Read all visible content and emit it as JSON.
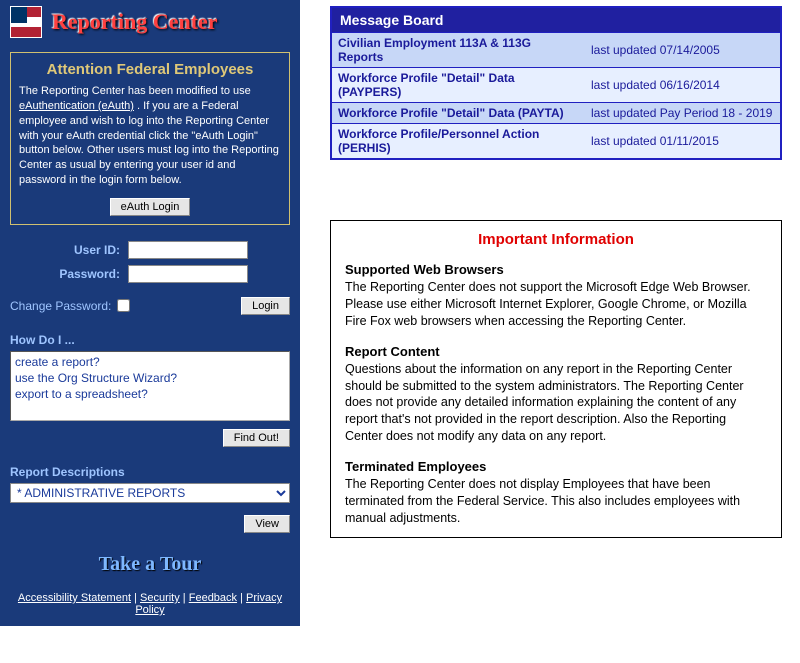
{
  "header": {
    "site_title": "Reporting Center"
  },
  "sidebar": {
    "attention": {
      "heading": "Attention Federal Employees",
      "text_pre": "The Reporting Center has been modified to use ",
      "eauth_link": "eAuthentication (eAuth)",
      "text_post": " . If you are a Federal employee and wish to log into the Reporting Center with your eAuth credential click the \"eAuth Login\" button below. Other users must log into the Reporting Center as usual by entering your user id and password in the login form below.",
      "eauth_button": "eAuth Login"
    },
    "login": {
      "user_label": "User ID:",
      "pass_label": "Password:",
      "change_pw_label": "Change Password:",
      "login_button": "Login"
    },
    "howdo": {
      "heading": "How Do I ...",
      "items": [
        "create a report?",
        "use the Org Structure Wizard?",
        "export to a spreadsheet?"
      ],
      "find_button": "Find Out!"
    },
    "reports": {
      "heading": "Report Descriptions",
      "selected": "* ADMINISTRATIVE REPORTS",
      "view_button": "View"
    },
    "tour": "Take a Tour",
    "footer": {
      "a": "Accessibility Statement",
      "b": "Security",
      "c": "Feedback",
      "d": "Privacy Policy"
    }
  },
  "message_board": {
    "title": "Message Board",
    "rows": [
      {
        "name": "Civilian Employment 113A & 113G Reports",
        "date": "last updated 07/14/2005"
      },
      {
        "name": "Workforce Profile \"Detail\" Data (PAYPERS)",
        "date": "last updated 06/16/2014"
      },
      {
        "name": "Workforce Profile \"Detail\" Data (PAYTA)",
        "date": "last updated Pay Period 18 - 2019"
      },
      {
        "name": "Workforce Profile/Personnel Action (PERHIS)",
        "date": "last updated 01/11/2015"
      }
    ]
  },
  "info": {
    "title": "Important Information",
    "sections": [
      {
        "heading": "Supported Web Browsers",
        "body": "The Reporting Center does not support the Microsoft Edge Web Browser. Please use either Microsoft Internet Explorer, Google Chrome, or Mozilla Fire Fox web browsers when accessing the Reporting Center."
      },
      {
        "heading": "Report Content",
        "body": "Questions about the information on any report in the Reporting Center should be submitted to the system administrators. The Reporting Center does not provide any detailed information explaining the content of any report that's not provided in the report description. Also the Reporting Center does not modify any data on any report."
      },
      {
        "heading": "Terminated Employees",
        "body": "The Reporting Center does not display Employees that have been terminated from the Federal Service. This also includes employees with manual adjustments."
      }
    ]
  }
}
